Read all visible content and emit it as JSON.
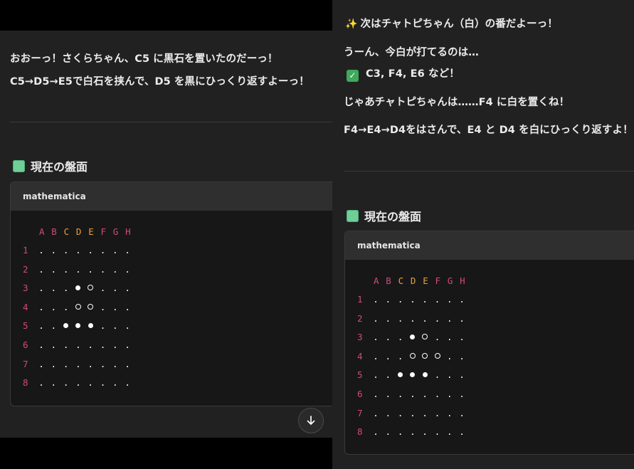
{
  "left": {
    "line1_prefix": "おおーっ！さくらちゃん、",
    "line1_move": "C5",
    "line1_suffix": " に黒石を置いたのだーっ！",
    "line2_path": "C5→D5→E5で白石を挟んで、",
    "line2_target": "D5",
    "line2_suffix": " を黒にひっくり返すよーっ！",
    "heading": "現在の盤面",
    "code_lang": "mathematica",
    "board": {
      "columns": [
        "A",
        "B",
        "C",
        "D",
        "E",
        "F",
        "G",
        "H"
      ],
      "highlight_columns": [
        "C",
        "D",
        "E"
      ],
      "rows": [
        {
          "num": "1",
          "cells": [
            ".",
            ".",
            ".",
            ".",
            ".",
            ".",
            ".",
            "."
          ]
        },
        {
          "num": "2",
          "cells": [
            ".",
            ".",
            ".",
            ".",
            ".",
            ".",
            ".",
            "."
          ]
        },
        {
          "num": "3",
          "cells": [
            ".",
            ".",
            ".",
            "B",
            "W",
            ".",
            ".",
            "."
          ]
        },
        {
          "num": "4",
          "cells": [
            ".",
            ".",
            ".",
            "W",
            "W",
            ".",
            ".",
            "."
          ]
        },
        {
          "num": "5",
          "cells": [
            ".",
            ".",
            "B",
            "B",
            "B",
            ".",
            ".",
            "."
          ]
        },
        {
          "num": "6",
          "cells": [
            ".",
            ".",
            ".",
            ".",
            ".",
            ".",
            ".",
            "."
          ]
        },
        {
          "num": "7",
          "cells": [
            ".",
            ".",
            ".",
            ".",
            ".",
            ".",
            ".",
            "."
          ]
        },
        {
          "num": "8",
          "cells": [
            ".",
            ".",
            ".",
            ".",
            ".",
            ".",
            ".",
            "."
          ]
        }
      ]
    }
  },
  "right": {
    "line1": "次はチャトピちゃん（白）の番だよーっ！",
    "line2": "うーん、今白が打てるのは…",
    "line3_moves": "C3, F4, E6",
    "line3_suffix": " など！",
    "line4_prefix": "じゃあチャトピちゃんは……",
    "line4_move": "F4",
    "line4_suffix": " に白を置くね！",
    "line5_path": "F4→E4→D4をはさんで、",
    "line5_t1": "E4",
    "line5_mid": " と ",
    "line5_t2": "D4",
    "line5_suffix": " を白にひっくり返すよ！",
    "heading": "現在の盤面",
    "code_lang": "mathematica",
    "board": {
      "columns": [
        "A",
        "B",
        "C",
        "D",
        "E",
        "F",
        "G",
        "H"
      ],
      "highlight_columns": [
        "C",
        "D",
        "E"
      ],
      "rows": [
        {
          "num": "1",
          "cells": [
            ".",
            ".",
            ".",
            ".",
            ".",
            ".",
            ".",
            "."
          ]
        },
        {
          "num": "2",
          "cells": [
            ".",
            ".",
            ".",
            ".",
            ".",
            ".",
            ".",
            "."
          ]
        },
        {
          "num": "3",
          "cells": [
            ".",
            ".",
            ".",
            "B",
            "W",
            ".",
            ".",
            "."
          ]
        },
        {
          "num": "4",
          "cells": [
            ".",
            ".",
            ".",
            "W",
            "W",
            "W",
            ".",
            "."
          ]
        },
        {
          "num": "5",
          "cells": [
            ".",
            ".",
            "B",
            "B",
            "B",
            ".",
            ".",
            "."
          ]
        },
        {
          "num": "6",
          "cells": [
            ".",
            ".",
            ".",
            ".",
            ".",
            ".",
            ".",
            "."
          ]
        },
        {
          "num": "7",
          "cells": [
            ".",
            ".",
            ".",
            ".",
            ".",
            ".",
            ".",
            "."
          ]
        },
        {
          "num": "8",
          "cells": [
            ".",
            ".",
            ".",
            ".",
            ".",
            ".",
            ".",
            "."
          ]
        }
      ]
    }
  },
  "icons": {
    "scroll_down": "arrow-down-icon",
    "heading": "green-square-icon",
    "check": "check-mark-icon",
    "sparkle": "sparkles-icon"
  },
  "colors": {
    "pane_bg": "#212121",
    "code_bg": "#171717",
    "row_label": "#d14a7a",
    "col_highlight": "#e6a23c"
  }
}
